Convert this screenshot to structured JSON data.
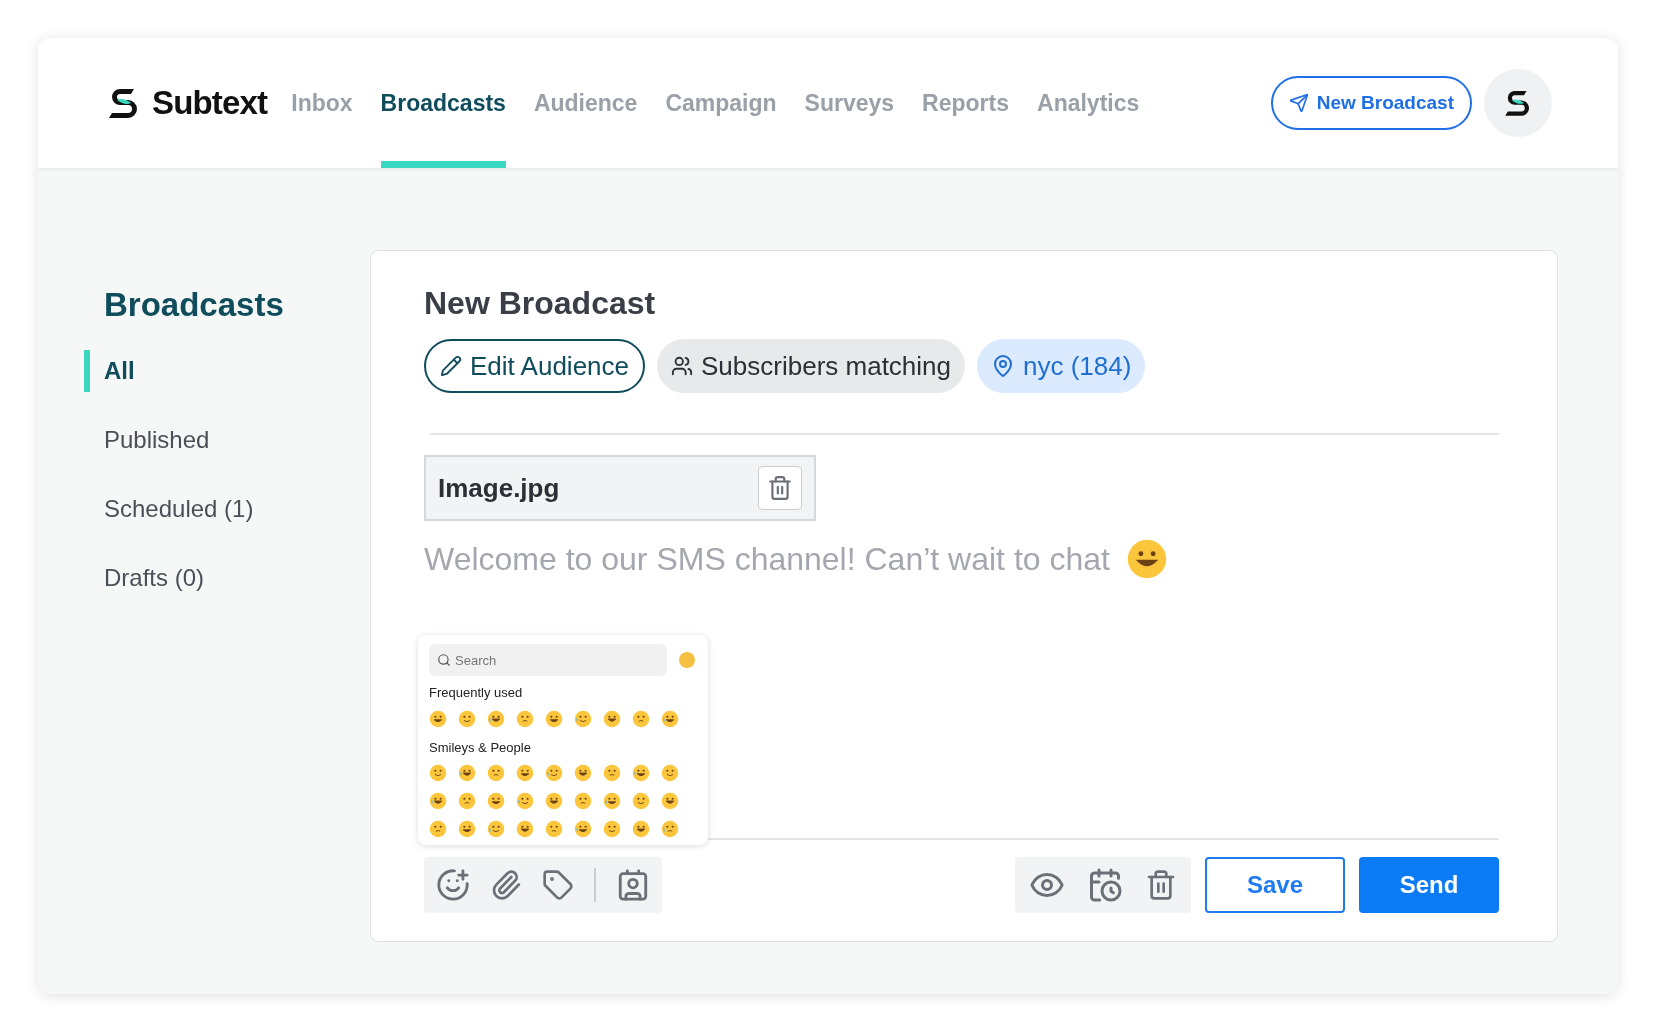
{
  "brand": {
    "name": "Subtext"
  },
  "nav": [
    {
      "label": "Inbox",
      "selected": false
    },
    {
      "label": "Broadcasts",
      "selected": true
    },
    {
      "label": "Audience",
      "selected": false
    },
    {
      "label": "Campaign",
      "selected": false
    },
    {
      "label": "Surveys",
      "selected": false
    },
    {
      "label": "Reports",
      "selected": false
    },
    {
      "label": "Analytics",
      "selected": false
    }
  ],
  "new_broadcast_button": "New Broadcast",
  "sidebar": {
    "title": "Broadcasts",
    "items": [
      {
        "label": "All",
        "selected": true
      },
      {
        "label": "Published",
        "selected": false
      },
      {
        "label": "Scheduled (1)",
        "selected": false
      },
      {
        "label": "Drafts (0)",
        "selected": false
      }
    ]
  },
  "composer": {
    "title": "New Broadcast",
    "chips": [
      {
        "kind": "edit",
        "label": "Edit Audience"
      },
      {
        "kind": "group",
        "label": "Subscribers matching"
      },
      {
        "kind": "location",
        "label": "nyc (184)"
      }
    ],
    "attachment": "Image.jpg",
    "message": "Welcome to our SMS channel! Can’t wait to chat",
    "emoji_picker": {
      "placeholder": "Search",
      "sections": [
        "Frequently used",
        "Smileys & People"
      ]
    },
    "actions": [
      "Save",
      "Send"
    ]
  }
}
